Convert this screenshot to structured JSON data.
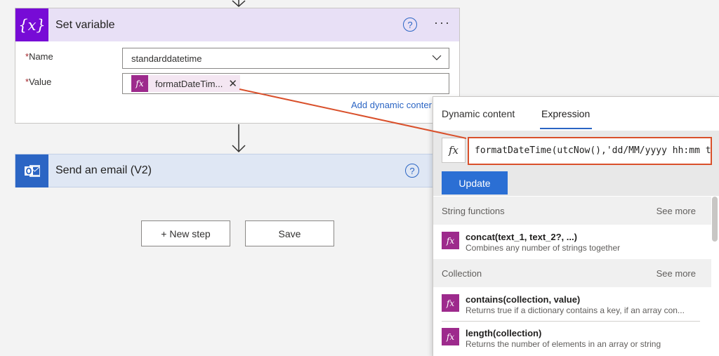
{
  "set_variable": {
    "title": "Set variable",
    "icon": "variable-icon",
    "icon_text": "{x}",
    "help": "?",
    "more": "···",
    "name_label": "Name",
    "name_value": "standarddatetime",
    "value_label": "Value",
    "required_mark": "*",
    "token_fx": "fx",
    "token_label": "formatDateTim...",
    "token_remove": "✕",
    "add_dynamic": "Add dynamic conter"
  },
  "send_email": {
    "title": "Send an email (V2)",
    "icon": "outlook-icon",
    "help": "?"
  },
  "buttons": {
    "new_step": "+ New step",
    "save": "Save"
  },
  "panel": {
    "tabs": [
      "Dynamic content",
      "Expression"
    ],
    "active_tab": "Expression",
    "fx": "fx",
    "expression": "formatDateTime(utcNow(),'dd/MM/yyyy hh:mm tt",
    "update_label": "Update",
    "sections": [
      {
        "name": "String functions",
        "see_more": "See more",
        "functions": [
          {
            "signature": "concat(text_1, text_2?, ...)",
            "description": "Combines any number of strings together"
          }
        ]
      },
      {
        "name": "Collection",
        "see_more": "See more",
        "functions": [
          {
            "signature": "contains(collection, value)",
            "description": "Returns true if a dictionary contains a key, if an array con..."
          },
          {
            "signature": "length(collection)",
            "description": "Returns the number of elements in an array or string"
          }
        ]
      }
    ]
  },
  "colors": {
    "variable_accent": "#770bd6",
    "email_accent": "#2b65c4",
    "function_accent": "#9d2a8c",
    "callout": "#d9502b",
    "update_button": "#2b6fd4"
  }
}
